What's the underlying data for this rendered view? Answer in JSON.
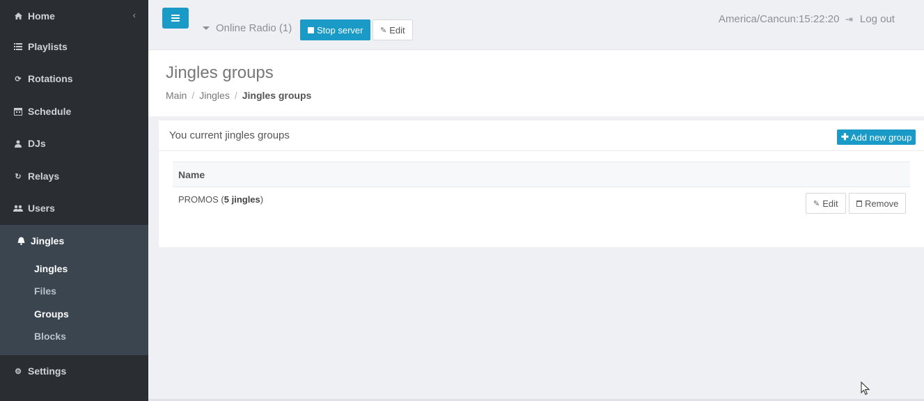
{
  "sidebar": {
    "items": [
      {
        "label": "Home",
        "icon": "home-icon"
      },
      {
        "label": "Playlists",
        "icon": "list-icon"
      },
      {
        "label": "Rotations",
        "icon": "refresh-icon"
      },
      {
        "label": "Schedule",
        "icon": "calendar-icon"
      },
      {
        "label": "DJs",
        "icon": "user-icon"
      },
      {
        "label": "Relays",
        "icon": "repeat-icon"
      },
      {
        "label": "Users",
        "icon": "users-icon"
      },
      {
        "label": "Jingles",
        "icon": "bell-icon"
      },
      {
        "label": "Settings",
        "icon": "gears-icon"
      }
    ],
    "jingles_sub": [
      {
        "label": "Jingles"
      },
      {
        "label": "Files"
      },
      {
        "label": "Groups"
      },
      {
        "label": "Blocks"
      }
    ]
  },
  "topbar": {
    "station": "Online Radio (1)",
    "stop_label": "Stop server",
    "edit_label": "Edit",
    "clock": "America/Cancun:15:22:20",
    "logout_label": "Log out"
  },
  "header": {
    "title": "Jingles groups",
    "breadcrumb": [
      "Main",
      "Jingles",
      "Jingles groups"
    ]
  },
  "panel": {
    "title": "You current jingles groups",
    "add_label": "Add new group",
    "table": {
      "columns": [
        "Name"
      ],
      "rows": [
        {
          "name": "PROMOS",
          "count": "5 jingles",
          "edit_label": "Edit",
          "remove_label": "Remove"
        }
      ]
    }
  },
  "colors": {
    "sidebar": "#2a2d31",
    "accent": "#1a9ac6"
  }
}
